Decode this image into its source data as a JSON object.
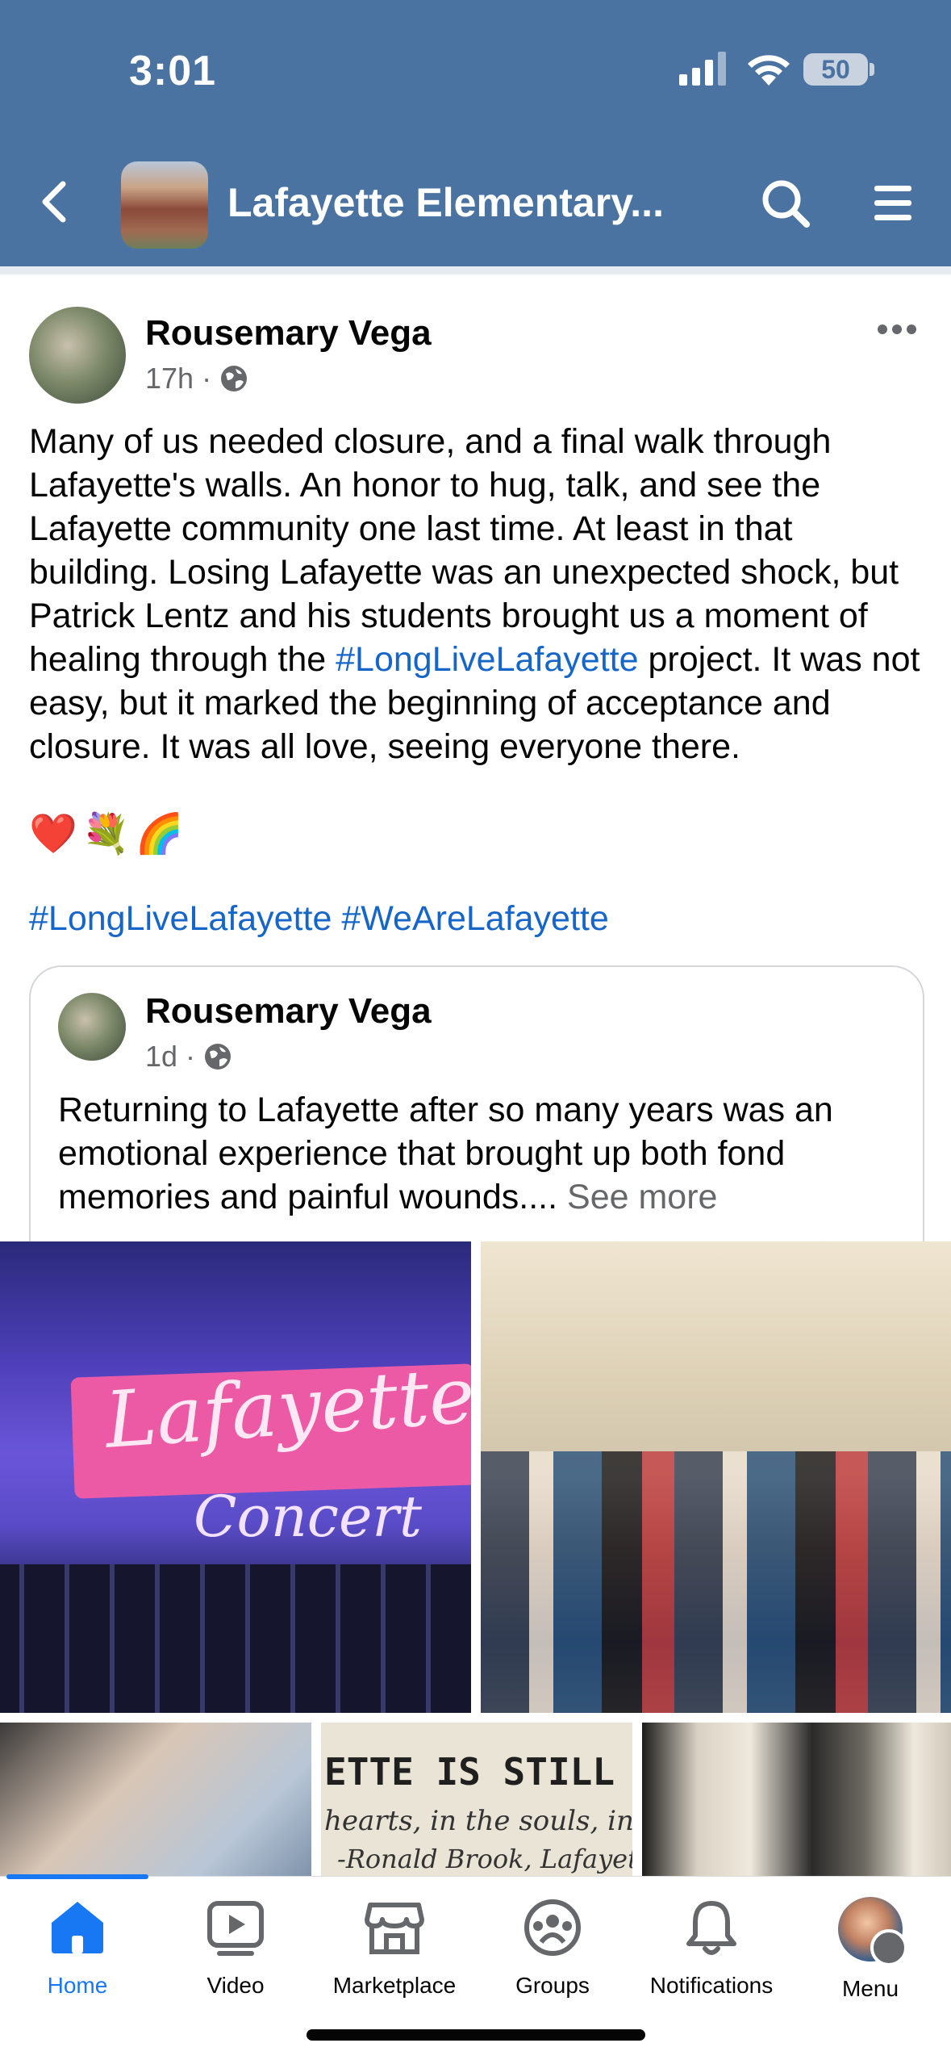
{
  "status_bar": {
    "time": "3:01",
    "battery": "50"
  },
  "header": {
    "title": "Lafayette Elementary..."
  },
  "post": {
    "author": "Rousemary Vega",
    "time": "17h",
    "body_before_tag": "Many of us needed closure, and a final walk through Lafayette's walls. An honor to hug, talk, and see the Lafayette community one last time. At least in that building. Losing Lafayette was an unexpected shock, but Patrick Lentz and his students brought us a moment of healing through the ",
    "body_tag": "#LongLiveLafayette",
    "body_after_tag": " project. It was not easy, but it marked the beginning of acceptance and closure. It was all love, seeing everyone there.",
    "emojis": "❤️💐🌈",
    "tags": "#LongLiveLafayette #WeAreLafayette"
  },
  "shared_post": {
    "author": "Rousemary Vega",
    "time": "1d",
    "text": "Returning to Lafayette after so many years was an emotional experience that brought up both fond memories and painful wounds....",
    "see_more": "See more"
  },
  "photos": {
    "concert_word": "Lafayette",
    "concert_word2": "Concert",
    "wall_line1": "ETTE IS STILL H",
    "wall_line2": "hearts, in the souls, in the",
    "wall_line3": "-Ronald Brook, Lafayette Paren"
  },
  "nav": {
    "items": [
      {
        "label": "Home",
        "icon": "home-icon",
        "active": true
      },
      {
        "label": "Video",
        "icon": "video-icon"
      },
      {
        "label": "Marketplace",
        "icon": "marketplace-icon"
      },
      {
        "label": "Groups",
        "icon": "groups-icon"
      },
      {
        "label": "Notifications",
        "icon": "bell-icon"
      },
      {
        "label": "Menu",
        "icon": "menu-avatar"
      }
    ]
  },
  "colors": {
    "header_bg": "#4b73a2",
    "link": "#1666c9",
    "active": "#1877f2"
  }
}
